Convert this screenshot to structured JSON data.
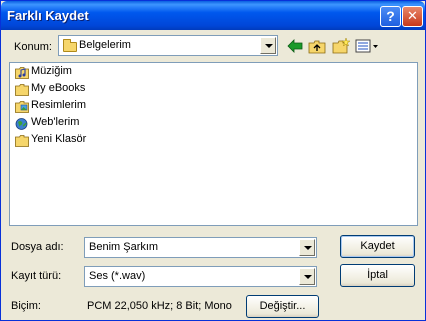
{
  "window": {
    "title": "Farklı Kaydet",
    "help_glyph": "?",
    "close_glyph": "✕"
  },
  "location": {
    "label": "Konum:",
    "value": "Belgelerim"
  },
  "toolbar": {
    "icons": [
      "back-arrow-icon",
      "up-folder-icon",
      "new-folder-icon",
      "views-menu-icon"
    ]
  },
  "files": [
    {
      "name": "Müziğim",
      "icon": "music-folder-icon"
    },
    {
      "name": "My eBooks",
      "icon": "folder-icon"
    },
    {
      "name": "Resimlerim",
      "icon": "pictures-folder-icon"
    },
    {
      "name": "Web'lerim",
      "icon": "web-folder-icon"
    },
    {
      "name": "Yeni Klasör",
      "icon": "folder-icon"
    }
  ],
  "filename": {
    "label": "Dosya adı:",
    "value": "Benim Şarkım"
  },
  "filetype": {
    "label": "Kayıt türü:",
    "value": "Ses (*.wav)"
  },
  "format": {
    "label": "Biçim:",
    "value": "PCM 22,050 kHz; 8 Bit; Mono",
    "change_label": "Değiştir..."
  },
  "buttons": {
    "save_label": "Kaydet",
    "cancel_label": "İptal"
  },
  "colors": {
    "titlebar": "#0058ee",
    "dialog_bg": "#ece9d8",
    "border": "#7f9db9"
  }
}
